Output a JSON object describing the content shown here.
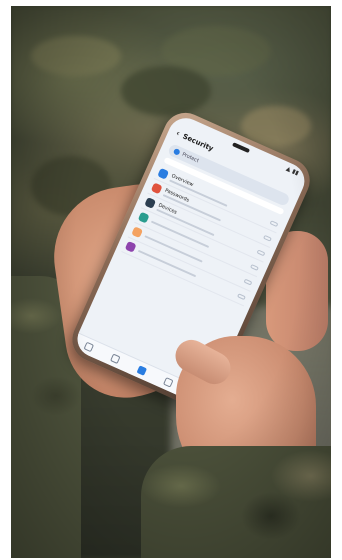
{
  "phone": {
    "status_time": "",
    "status_icons": "▲ ▮▮",
    "title": "Security",
    "subtitle": "",
    "search_label": "Protect",
    "card_text": "",
    "rows": [
      {
        "title": "Overview",
        "button": "",
        "color": "#2a7de1"
      },
      {
        "title": "Passwords",
        "button": "",
        "color": "#e0533d"
      },
      {
        "title": "Devices",
        "button": "",
        "color": "#2c3e50"
      },
      {
        "title": "",
        "button": "",
        "color": "#2a9d8f"
      },
      {
        "title": "",
        "button": "",
        "color": "#f4a261"
      },
      {
        "title": "",
        "button": "",
        "color": "#8e44ad"
      }
    ],
    "accent_color": "#2a7de1"
  },
  "icons": {
    "back": "back-arrow-icon",
    "search": "search-icon",
    "nav": [
      "home-icon",
      "list-icon",
      "shield-icon",
      "profile-icon",
      "menu-icon"
    ]
  }
}
